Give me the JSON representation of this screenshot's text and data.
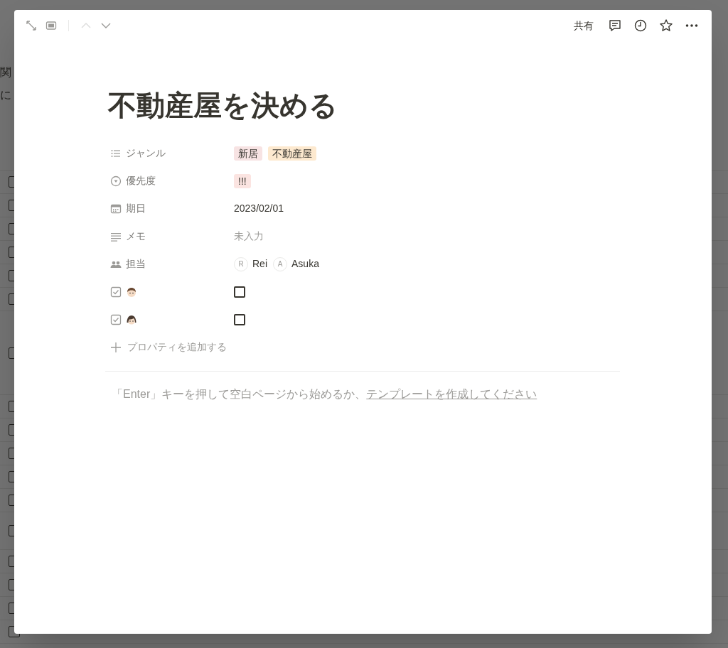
{
  "background": {
    "intro_lines": [
      "関",
      "に"
    ]
  },
  "toolbar": {
    "up_disabled": true,
    "down_disabled": false,
    "share": "共有"
  },
  "page": {
    "title": "不動産屋を決める",
    "properties": [
      {
        "kind": "multi_select",
        "label": "ジャンル",
        "tags": [
          {
            "text": "新居",
            "color": "#f7e3e3"
          },
          {
            "text": "不動産屋",
            "color": "#fde9cf"
          }
        ]
      },
      {
        "kind": "select",
        "label": "優先度",
        "tags": [
          {
            "text": "!!!",
            "color": "#fbe4e1"
          }
        ]
      },
      {
        "kind": "date",
        "label": "期日",
        "value": "2023/02/01"
      },
      {
        "kind": "text",
        "label": "メモ",
        "placeholder": "未入力"
      },
      {
        "kind": "person",
        "label": "担当",
        "people": [
          {
            "initial": "R",
            "name": "Rei"
          },
          {
            "initial": "A",
            "name": "Asuka"
          }
        ]
      },
      {
        "kind": "checkbox",
        "checked": false
      },
      {
        "kind": "checkbox",
        "checked": false
      }
    ],
    "add_property": "プロパティを追加する",
    "empty_hint": "「Enter」キーを押して空白ページから始めるか、",
    "template_link": "テンプレートを作成してください"
  }
}
